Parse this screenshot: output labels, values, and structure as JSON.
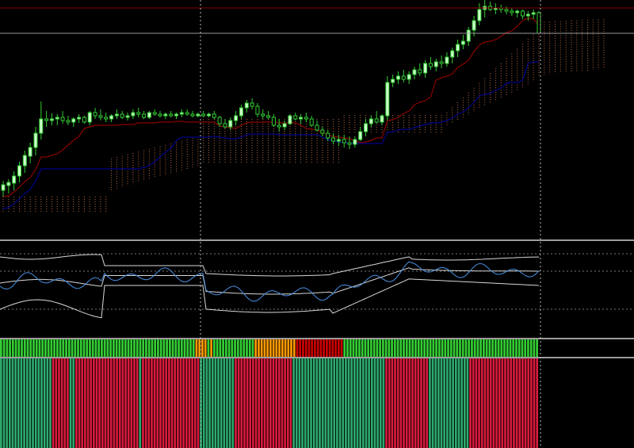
{
  "chart_data": [
    {
      "type": "candlestick",
      "title": "",
      "description_free": true,
      "series": [
        {
          "name": "",
          "color": "#8b0000",
          "role": "tenkan"
        },
        {
          "name": "",
          "color": "#00008b",
          "role": "kijun"
        },
        {
          "name": "",
          "color": "#c87850",
          "role": "cloud"
        }
      ],
      "candles": [
        [
          240,
          248,
          228,
          233
        ],
        [
          234,
          244,
          226,
          230
        ],
        [
          231,
          240,
          216,
          222
        ],
        [
          222,
          230,
          204,
          209
        ],
        [
          209,
          218,
          190,
          196
        ],
        [
          197,
          206,
          180,
          186
        ],
        [
          186,
          196,
          160,
          168
        ],
        [
          168,
          176,
          128,
          150
        ],
        [
          150,
          160,
          140,
          152
        ],
        [
          152,
          158,
          143,
          150
        ],
        [
          150,
          158,
          144,
          148
        ],
        [
          148,
          156,
          140,
          152
        ],
        [
          152,
          158,
          146,
          154
        ],
        [
          154,
          160,
          148,
          150
        ],
        [
          150,
          155,
          144,
          148
        ],
        [
          148,
          156,
          146,
          154
        ],
        [
          154,
          158,
          140,
          142
        ],
        [
          142,
          150,
          136,
          146
        ],
        [
          146,
          152,
          138,
          148
        ],
        [
          148,
          154,
          142,
          150
        ],
        [
          150,
          154,
          144,
          146
        ],
        [
          146,
          150,
          138,
          144
        ],
        [
          144,
          150,
          140,
          148
        ],
        [
          148,
          152,
          142,
          146
        ],
        [
          146,
          150,
          138,
          142
        ],
        [
          142,
          148,
          136,
          144
        ],
        [
          144,
          150,
          140,
          148
        ],
        [
          148,
          150,
          140,
          142
        ],
        [
          142,
          146,
          138,
          144
        ],
        [
          144,
          148,
          140,
          146
        ],
        [
          146,
          150,
          142,
          144
        ],
        [
          144,
          148,
          140,
          146
        ],
        [
          146,
          150,
          142,
          144
        ],
        [
          144,
          148,
          138,
          142
        ],
        [
          142,
          146,
          138,
          144
        ],
        [
          144,
          148,
          140,
          146
        ],
        [
          146,
          148,
          142,
          144
        ],
        [
          144,
          148,
          140,
          146
        ],
        [
          146,
          148,
          142,
          144
        ],
        [
          144,
          150,
          140,
          148
        ],
        [
          148,
          160,
          146,
          156
        ],
        [
          156,
          162,
          150,
          160
        ],
        [
          160,
          164,
          148,
          152
        ],
        [
          152,
          158,
          140,
          146
        ],
        [
          146,
          150,
          132,
          136
        ],
        [
          136,
          142,
          126,
          130
        ],
        [
          130,
          138,
          124,
          134
        ],
        [
          134,
          148,
          130,
          144
        ],
        [
          144,
          150,
          138,
          146
        ],
        [
          146,
          150,
          140,
          148
        ],
        [
          148,
          160,
          144,
          158
        ],
        [
          158,
          166,
          150,
          160
        ],
        [
          160,
          164,
          152,
          156
        ],
        [
          156,
          158,
          144,
          146
        ],
        [
          146,
          152,
          142,
          150
        ],
        [
          150,
          156,
          144,
          148
        ],
        [
          148,
          154,
          142,
          150
        ],
        [
          150,
          160,
          146,
          158
        ],
        [
          158,
          166,
          152,
          164
        ],
        [
          164,
          172,
          160,
          168
        ],
        [
          168,
          178,
          164,
          174
        ],
        [
          174,
          182,
          168,
          178
        ],
        [
          178,
          184,
          170,
          176
        ],
        [
          176,
          186,
          170,
          180
        ],
        [
          180,
          188,
          172,
          182
        ],
        [
          182,
          186,
          172,
          176
        ],
        [
          176,
          178,
          160,
          166
        ],
        [
          166,
          172,
          150,
          156
        ],
        [
          156,
          160,
          146,
          150
        ],
        [
          150,
          156,
          140,
          154
        ],
        [
          154,
          158,
          144,
          146
        ],
        [
          146,
          152,
          96,
          104
        ],
        [
          104,
          110,
          94,
          100
        ],
        [
          100,
          106,
          90,
          96
        ],
        [
          96,
          104,
          88,
          100
        ],
        [
          100,
          106,
          90,
          94
        ],
        [
          94,
          100,
          84,
          88
        ],
        [
          88,
          96,
          80,
          92
        ],
        [
          92,
          98,
          76,
          80
        ],
        [
          80,
          88,
          72,
          84
        ],
        [
          84,
          90,
          74,
          78
        ],
        [
          78,
          86,
          70,
          80
        ],
        [
          80,
          84,
          66,
          72
        ],
        [
          72,
          80,
          60,
          64
        ],
        [
          64,
          72,
          50,
          56
        ],
        [
          56,
          62,
          44,
          52
        ],
        [
          52,
          58,
          34,
          38
        ],
        [
          38,
          46,
          20,
          26
        ],
        [
          26,
          32,
          4,
          12
        ],
        [
          12,
          22,
          0,
          8
        ],
        [
          8,
          14,
          2,
          12
        ],
        [
          12,
          18,
          4,
          10
        ],
        [
          10,
          16,
          6,
          12
        ],
        [
          12,
          18,
          8,
          14
        ],
        [
          14,
          20,
          10,
          16
        ],
        [
          16,
          22,
          12,
          14
        ],
        [
          14,
          24,
          12,
          20
        ],
        [
          20,
          26,
          14,
          18
        ],
        [
          18,
          24,
          12,
          16
        ],
        [
          16,
          40,
          14,
          42
        ]
      ]
    },
    {
      "type": "line",
      "title": "",
      "series": [
        {
          "name": "",
          "color": "#4a90e2"
        },
        {
          "name": "",
          "color": "#d8d8d8"
        }
      ]
    },
    {
      "type": "bar",
      "title": "",
      "colors": [
        "#33cc33",
        "#ff9900",
        "#cc0000"
      ],
      "values": [
        0,
        0,
        0,
        0,
        0,
        0,
        0,
        0,
        0,
        0,
        0,
        0,
        0,
        0,
        0,
        0,
        0,
        0,
        0,
        0,
        0,
        0,
        0,
        0,
        0,
        0,
        0,
        0,
        0,
        0,
        0,
        0,
        0,
        0,
        0,
        0,
        0,
        0,
        0,
        0,
        0,
        0,
        0,
        0,
        0,
        0,
        0,
        0,
        0,
        0,
        0,
        0,
        0,
        0,
        0,
        0,
        0,
        0,
        0,
        0,
        0,
        0,
        0,
        0,
        0,
        0,
        1,
        1,
        1,
        1,
        0,
        1,
        0,
        0,
        0,
        0,
        0,
        0,
        0,
        0,
        0,
        0,
        0,
        0,
        0,
        0,
        1,
        1,
        1,
        1,
        1,
        1,
        1,
        1,
        1,
        1,
        1,
        1,
        1,
        1,
        2,
        2,
        2,
        2,
        2,
        2,
        2,
        2,
        2,
        2,
        2,
        2,
        2,
        2,
        2,
        2,
        0,
        0,
        0,
        0,
        0,
        0,
        0,
        0,
        0,
        0,
        0,
        0,
        0,
        0,
        0,
        0,
        0,
        0,
        0,
        0,
        0,
        0,
        0,
        0,
        0,
        0,
        0,
        0,
        0,
        0,
        0,
        0,
        0,
        0,
        0,
        0,
        0,
        0,
        0,
        0,
        0,
        0,
        0,
        0,
        0,
        0,
        0,
        0,
        0,
        0,
        0,
        0,
        0,
        0,
        0,
        0,
        0,
        0,
        0,
        0,
        0,
        0,
        0,
        0,
        0,
        0
      ]
    },
    {
      "type": "bar",
      "title": "",
      "colors": [
        "#2eaa6e",
        "#d91a3c"
      ],
      "segments": [
        {
          "count": 18,
          "color": 0
        },
        {
          "count": 6,
          "color": 1
        },
        {
          "count": 2,
          "color": 0
        },
        {
          "count": 22,
          "color": 1
        },
        {
          "count": 1,
          "color": 0
        },
        {
          "count": 20,
          "color": 1
        },
        {
          "count": 12,
          "color": 0
        },
        {
          "count": 20,
          "color": 1
        },
        {
          "count": 32,
          "color": 0
        },
        {
          "count": 15,
          "color": 1
        },
        {
          "count": 14,
          "color": 0
        },
        {
          "count": 24,
          "color": 1
        }
      ]
    }
  ]
}
